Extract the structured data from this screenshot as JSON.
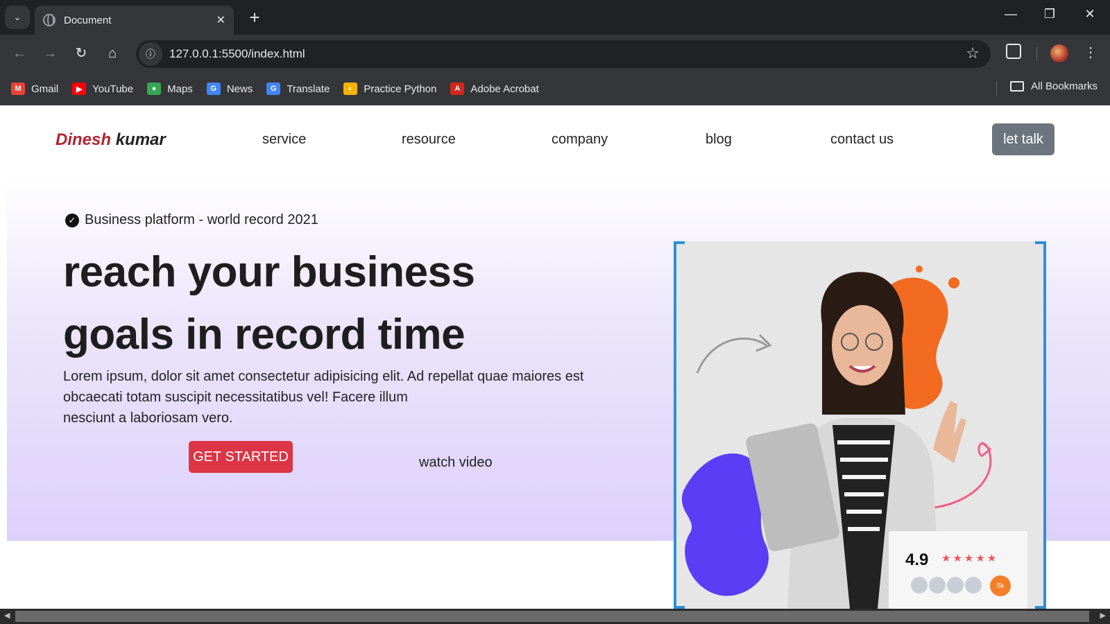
{
  "browser": {
    "tab_title": "Document",
    "url": "127.0.0.1:5500/index.html",
    "bookmarks": [
      {
        "label": "Gmail",
        "icon": "gmail-icon",
        "color": "#ea4335",
        "glyph": "M"
      },
      {
        "label": "YouTube",
        "icon": "youtube-icon",
        "color": "#ff0000",
        "glyph": "▶"
      },
      {
        "label": "Maps",
        "icon": "maps-icon",
        "color": "#34a853",
        "glyph": "●"
      },
      {
        "label": "News",
        "icon": "news-icon",
        "color": "#4285f4",
        "glyph": "G"
      },
      {
        "label": "Translate",
        "icon": "translate-icon",
        "color": "#4285f4",
        "glyph": "G"
      },
      {
        "label": "Practice Python",
        "icon": "practice-python-icon",
        "color": "#f4b400",
        "glyph": "◐"
      },
      {
        "label": "Adobe Acrobat",
        "icon": "adobe-acrobat-icon",
        "color": "#d4271b",
        "glyph": "A"
      }
    ],
    "all_bookmarks": "All Bookmarks"
  },
  "site": {
    "logo_first": "Dinesh",
    "logo_last": "kumar",
    "nav": [
      "service",
      "resource",
      "company",
      "blog",
      "contact us"
    ],
    "cta": "let talk"
  },
  "hero": {
    "badge": "Business platform - world record 2021",
    "headline_line1": "reach your business",
    "headline_line2": "goals in record time",
    "lead_line1": "Lorem ipsum, dolor sit amet consectetur adipisicing elit. Ad repellat quae maiores est",
    "lead_line2": "obcaecati totam suscipit necessitatibus vel! Facere illum",
    "lead_line3": "nesciunt a laboriosam vero.",
    "get_started": "GET STARTED",
    "watch_video": "watch video"
  },
  "rating": {
    "score": "4.9",
    "stars": "★★★★★",
    "count": "5k"
  },
  "colors": {
    "brand_red": "#b4232f",
    "button_red": "#dc3545",
    "talk_gray": "#6c757d",
    "frame_blue": "#2f8fd8",
    "splash_orange": "#f26b21",
    "splash_purple": "#5b3df5"
  }
}
